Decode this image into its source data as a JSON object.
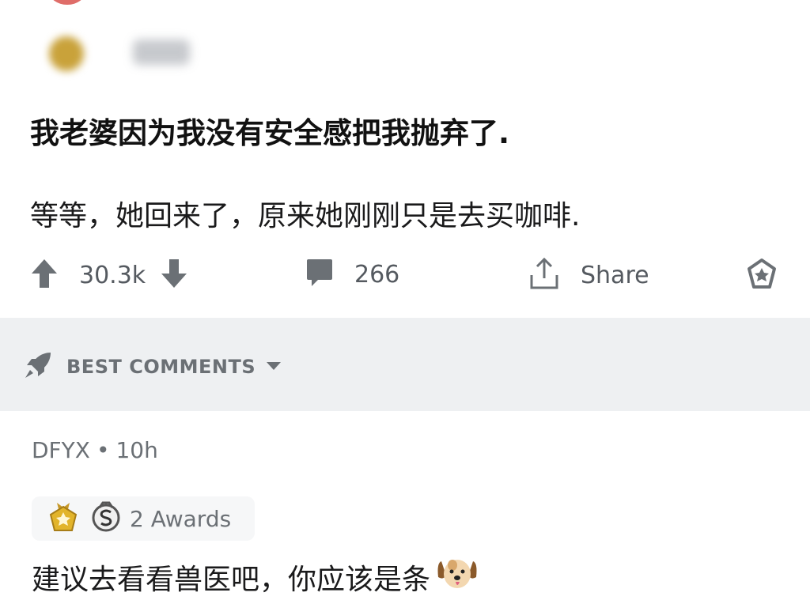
{
  "post": {
    "title": "我老婆因为我没有安全感把我抛弃了.",
    "body": "等等，她回来了，原来她刚刚只是去买咖啡."
  },
  "actions": {
    "upvotes": "30.3k",
    "comments": "266",
    "share_label": "Share"
  },
  "sort": {
    "label": "BEST COMMENTS"
  },
  "comment": {
    "author": "DFYX",
    "separator": "•",
    "time": "10h",
    "awards_label": "2 Awards",
    "body": "建议去看看兽医吧，你应该是条"
  },
  "colors": {
    "icon_gray": "#6b7075",
    "band_bg": "#eef0f2",
    "award_gold": "#e2b42b"
  },
  "icons": [
    "upvote-arrow-icon",
    "downvote-arrow-icon",
    "comment-bubble-icon",
    "share-icon",
    "award-icon",
    "rocket-icon",
    "dropdown-caret-icon",
    "gold-award-icon",
    "silver-award-icon",
    "dog-emoji-icon"
  ]
}
